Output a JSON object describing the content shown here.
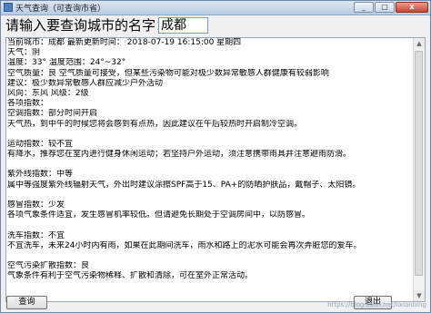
{
  "window": {
    "title": "天气查询（可查询市省）",
    "minimize": "_",
    "maximize": "□",
    "close": "x"
  },
  "prompt": {
    "label": "请输入要查询城市的名字：",
    "city_value": "成都"
  },
  "result_lines": [
    "当前城市：成都      最新更新时间：  2018-07-19 16:15:00   星期四",
    "天气：阴",
    "温度：33°    温度范围：24°~32°",
    "空气质量：良   空气质量可接受，但某些污染物可能对极少数异常敏感人群健康有较弱影响",
    "建议：极少数异常敏感人群应减少户外活动",
    "风向：东风     风级：2级",
    "各项指数：",
    "空调指数：部分时间开启",
    "天气热，到中午的时候您将会感到有点热，因此建议在午后较热时开启制冷空调。",
    "",
    "运动指数：较不宜",
    "有降水，推荐您在室内进行健身休闲运动；若坚持户外运动，须注意携带雨具并注意避雨防滑。",
    "",
    "紫外线指数：中等",
    "属中等强度紫外线辐射天气，外出时建议涂擦SPF高于15、PA+的防晒护肤品，戴帽子、太阳镜。",
    "",
    "感冒指数：少发",
    "各项气象条件适宜，发生感冒机率较低。但请避免长期处于空调房间中，以防感冒。",
    "",
    "洗车指数：不宜",
    "不宜洗车，未来24小时内有雨，如果在此期间洗车，雨水和路上的泥水可能会再次弄脏您的爱车。",
    "",
    "空气污染扩散指数：良",
    "气象条件有利于空气污染物稀释、扩散和清除，可在室外正常活动。"
  ],
  "buttons": {
    "query": "查询",
    "exit": "退出"
  },
  "watermark": "https://blog.csdn.net/lixianbing"
}
